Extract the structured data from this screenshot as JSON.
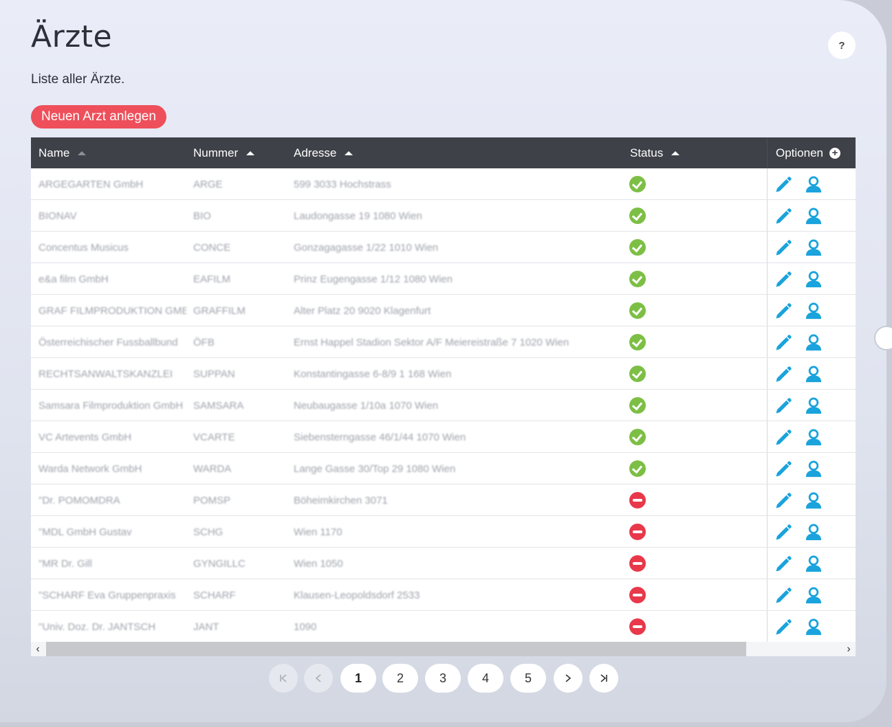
{
  "page": {
    "title": "Ärzte",
    "subtitle": "Liste aller Ärzte.",
    "help_label": "?",
    "new_button_label": "Neuen Arzt anlegen"
  },
  "table": {
    "columns": {
      "name": "Name",
      "number": "Nummer",
      "address": "Adresse",
      "status": "Status",
      "options": "Optionen"
    },
    "rows": [
      {
        "name": "ARGEGARTEN GmbH",
        "number": "ARGE",
        "address": "599 3033 Hochstrass",
        "status": "active"
      },
      {
        "name": "BIONAV",
        "number": "BIO",
        "address": "Laudongasse 19 1080 Wien",
        "status": "active"
      },
      {
        "name": "Concentus Musicus",
        "number": "CONCE",
        "address": "Gonzagagasse 1/22 1010 Wien",
        "status": "active"
      },
      {
        "name": "e&a film GmbH",
        "number": "EAFILM",
        "address": "Prinz Eugengasse 1/12 1080 Wien",
        "status": "active"
      },
      {
        "name": "GRAF FILMPRODUKTION GMBH",
        "number": "GRAFFILM",
        "address": "Alter Platz 20 9020 Klagenfurt",
        "status": "active"
      },
      {
        "name": "Österreichischer Fussballbund",
        "number": "ÖFB",
        "address": "Ernst Happel Stadion Sektor A/F Meiereistraße 7 1020 Wien",
        "status": "active"
      },
      {
        "name": "RECHTSANWALTSKANZLEI",
        "number": "SUPPAN",
        "address": "Konstantingasse 6-8/9 1 168 Wien",
        "status": "active"
      },
      {
        "name": "Samsara Filmproduktion GmbH",
        "number": "SAMSARA",
        "address": "Neubaugasse 1/10a 1070 Wien",
        "status": "active"
      },
      {
        "name": "VC Artevents GmbH",
        "number": "VCARTE",
        "address": "Siebensterngasse 46/1/44 1070 Wien",
        "status": "active"
      },
      {
        "name": "Warda Network GmbH",
        "number": "WARDA",
        "address": "Lange Gasse 30/Top 29 1080 Wien",
        "status": "active"
      },
      {
        "name": "\"Dr. POMOMDRA",
        "number": "POMSP",
        "address": "Böheimkirchen 3071",
        "status": "inactive"
      },
      {
        "name": "\"MDL GmbH Gustav",
        "number": "SCHG",
        "address": "Wien 1170",
        "status": "inactive"
      },
      {
        "name": "\"MR Dr. Gill",
        "number": "GYNGILLC",
        "address": "Wien 1050",
        "status": "inactive"
      },
      {
        "name": "\"SCHARF Eva Gruppenpraxis",
        "number": "SCHARF",
        "address": "Klausen-Leopoldsdorf 2533",
        "status": "inactive"
      },
      {
        "name": "\"Univ. Doz. Dr. JANTSCH",
        "number": "JANT",
        "address": "1090",
        "status": "inactive"
      }
    ]
  },
  "pagination": {
    "pages": [
      "1",
      "2",
      "3",
      "4",
      "5"
    ],
    "current": "1",
    "first_icon": "first-page-icon",
    "prev_icon": "chevron-left-icon",
    "next_icon": "chevron-right-icon",
    "last_icon": "last-page-icon"
  },
  "colors": {
    "accent": "#ee4f5a",
    "header_bg": "#3f4148",
    "status_ok": "#7dbf45",
    "status_inactive": "#e8384a",
    "action_icons": "#1aa3dc"
  }
}
